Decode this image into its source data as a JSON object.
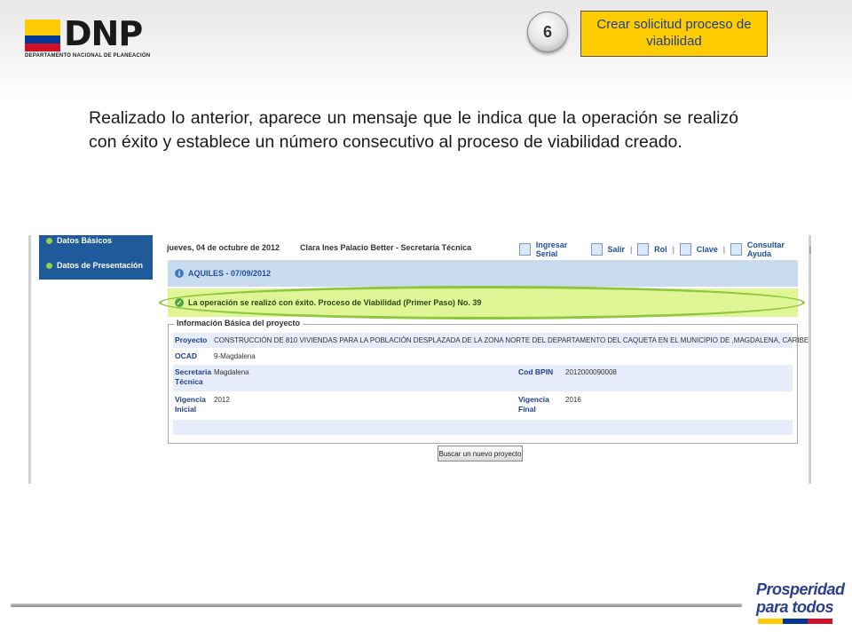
{
  "logo": {
    "word": "DNP",
    "subtitle": "DEPARTAMENTO NACIONAL DE PLANEACIÓN",
    "flag_colors": [
      "#ffcc00",
      "#003893",
      "#ce1126"
    ]
  },
  "step": {
    "number": "6",
    "title": "Crear solicitud proceso de viabilidad",
    "box_color": "#ffcc00"
  },
  "paragraph": "Realizado lo anterior, aparece un mensaje que le indica que la operación se realizó con éxito y establece un número consecutivo al proceso de viabilidad creado.",
  "app": {
    "sidebar": [
      {
        "label": "Datos Básicos"
      },
      {
        "label": "Datos de Presentación"
      }
    ],
    "header": {
      "date": "jueves, 04 de octubre de 2012",
      "user": "Clara Ines Palacio Better - Secretaría Técnica"
    },
    "toolbar": [
      {
        "label": "Ingresar Serial",
        "icon": "serial-icon"
      },
      {
        "label": "Salir",
        "icon": "exit-icon"
      },
      {
        "label": "Rol",
        "icon": "role-icon"
      },
      {
        "label": "Clave",
        "icon": "key-icon"
      },
      {
        "label": "Consultar Ayuda",
        "icon": "help-icon"
      }
    ],
    "project_bar": "AQUILES - 07/09/2012",
    "success_message": "La operación se realizó con éxito. Proceso de Viabilidad (Primer Paso) No. 39",
    "info_section": {
      "legend": "Información Básica del proyecto",
      "proyecto_label": "Proyecto",
      "proyecto_value": "CONSTRUCCIÓN DE 810 VIVIENDAS PARA LA POBLACIÓN DESPLAZADA DE LA ZONA NORTE DEL DEPARTAMENTO DEL CAQUETA EN EL MUNICIPIO DE ,MAGDALENA, CARIBE",
      "ocad_label": "OCAD",
      "ocad_value": "9-Magdalena",
      "secretaria_label": "Secretaria Técnica",
      "secretaria_value": "Magdalena",
      "bpin_label": "Cod BPIN",
      "bpin_value": "2012000090008",
      "vig_inicial_label": "Vigencia Inicial",
      "vig_inicial_value": "2012",
      "vig_final_label": "Vigencia Final",
      "vig_final_value": "2016"
    },
    "search_button": "Buscar un nuevo proyecto"
  },
  "footer": {
    "brand_line1": "Prosperidad",
    "brand_line2": "para todos"
  }
}
